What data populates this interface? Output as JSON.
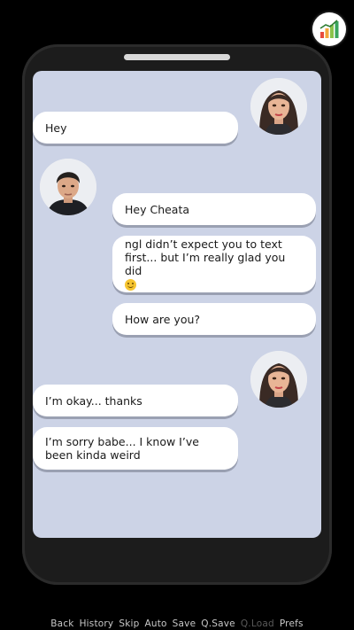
{
  "messages": [
    {
      "side": "left",
      "text": "Hey"
    },
    {
      "side": "right",
      "text": "Hey Cheata"
    },
    {
      "side": "right",
      "text": "ngl didn’t expect you to text first... but I’m really glad you did",
      "emoji": "slightly-smiling-face-icon"
    },
    {
      "side": "right",
      "text": "How are you?"
    },
    {
      "side": "left",
      "text": "I’m okay... thanks"
    },
    {
      "side": "left",
      "text": "I’m sorry babe... I know I’ve been kinda weird"
    }
  ],
  "quick_menu": [
    {
      "label": "Back",
      "enabled": true
    },
    {
      "label": "History",
      "enabled": true
    },
    {
      "label": "Skip",
      "enabled": true
    },
    {
      "label": "Auto",
      "enabled": true
    },
    {
      "label": "Save",
      "enabled": true
    },
    {
      "label": "Q.Save",
      "enabled": true
    },
    {
      "label": "Q.Load",
      "enabled": false
    },
    {
      "label": "Prefs",
      "enabled": true
    }
  ],
  "colors": {
    "screen_bg": "#ccd3e6",
    "bubble": "#ffffff",
    "phone_body": "#1c1c1c",
    "menu_text": "#c8c8c8",
    "menu_text_disabled": "#5a5a5a"
  },
  "icons": {
    "stats_button": "bar-chart-icon",
    "emoji": "slightly-smiling-face-icon"
  }
}
